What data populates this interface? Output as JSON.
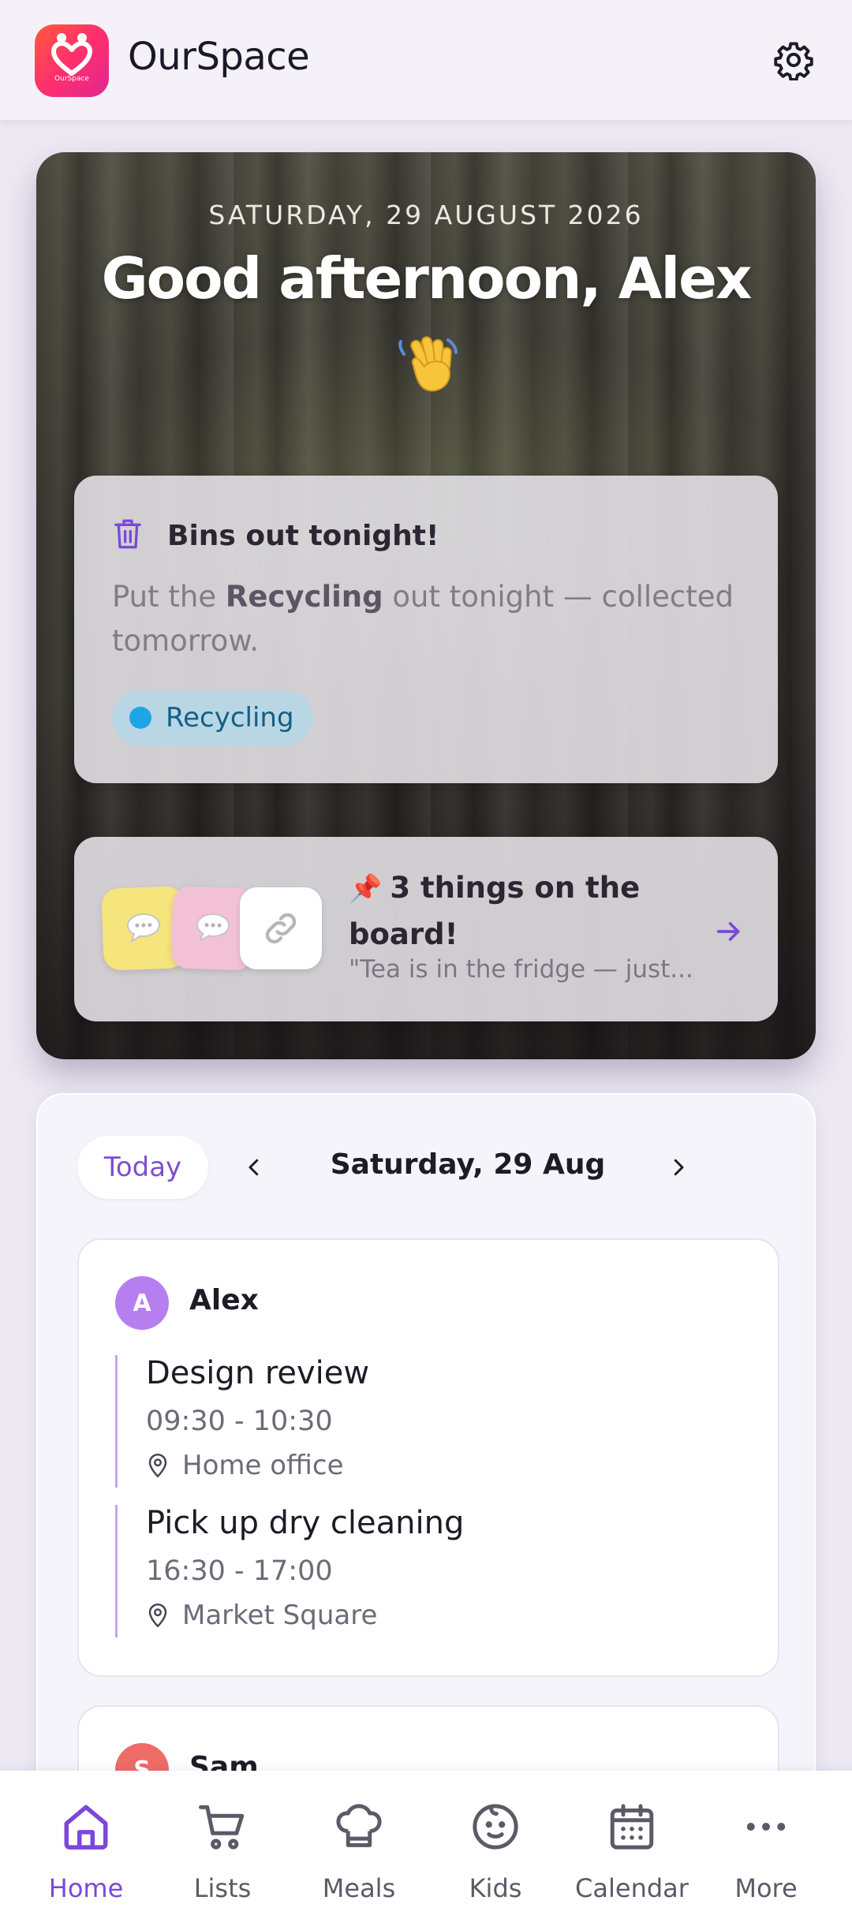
{
  "header": {
    "app_name": "OurSpace",
    "logo_text": "OurSpace"
  },
  "hero": {
    "date": "SATURDAY, 29 AUGUST 2026",
    "greeting": "Good afternoon, Alex",
    "greeting_emoji": "waving-hand"
  },
  "bins": {
    "title": "Bins out tonight!",
    "body_prefix": "Put the ",
    "body_bold": "Recycling",
    "body_suffix": " out tonight — collected tomorrow.",
    "tag": "Recycling",
    "tag_color": "#1da5e6"
  },
  "board": {
    "pin": "📌",
    "title": "3 things on the board!",
    "quote": "\"Tea is in the fridge — just..."
  },
  "schedule": {
    "today_label": "Today",
    "date_label": "Saturday, 29 Aug",
    "people": [
      {
        "initial": "A",
        "name": "Alex",
        "color": "#b57ff0",
        "events": [
          {
            "title": "Design review",
            "time": "09:30 - 10:30",
            "location": "Home office"
          },
          {
            "title": "Pick up dry cleaning",
            "time": "16:30 - 17:00",
            "location": "Market Square"
          }
        ]
      },
      {
        "initial": "S",
        "name": "Sam",
        "color": "#ef6b67"
      }
    ]
  },
  "nav": {
    "items": [
      {
        "label": "Home",
        "icon": "home-icon",
        "active": true
      },
      {
        "label": "Lists",
        "icon": "cart-icon"
      },
      {
        "label": "Meals",
        "icon": "chef-hat-icon"
      },
      {
        "label": "Kids",
        "icon": "baby-face-icon"
      },
      {
        "label": "Calendar",
        "icon": "calendar-icon"
      },
      {
        "label": "More",
        "icon": "more-icon"
      }
    ],
    "accent": "#7b48d9"
  }
}
